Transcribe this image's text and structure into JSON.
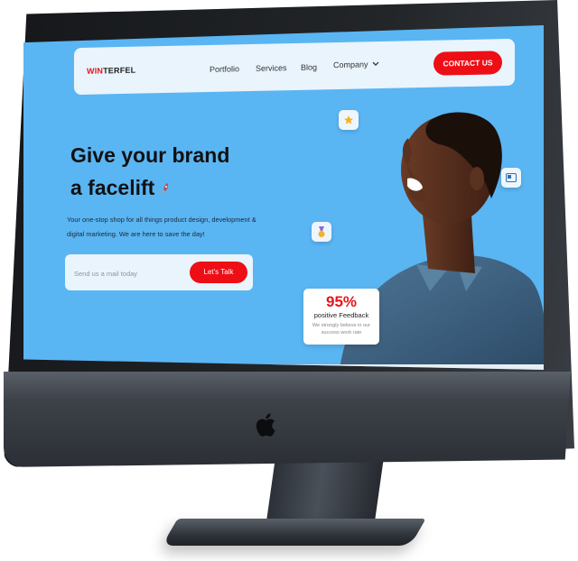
{
  "website": {
    "logo": {
      "part1": "WIN",
      "part2": "TERFEL"
    },
    "nav": {
      "items": [
        "Portfolio",
        "Services",
        "Blog",
        "Company"
      ],
      "contact_button": "CONTACT US"
    },
    "hero": {
      "title_line1": "Give your brand",
      "title_line2": "a facelift",
      "description": "Your one-stop shop for all things product design, development & digital marketing. We are here to save the day!",
      "email_placeholder": "Send us a mail today",
      "cta_button": "Let's Talk"
    },
    "feedback_card": {
      "percent": "95%",
      "label": "positive Feedback",
      "subtext": "We strongly believe in our success work rate"
    }
  },
  "colors": {
    "screen_background": "#5ab5f3",
    "accent_red": "#ee0e15",
    "navbar_background": "#e9f4fd"
  },
  "icons": [
    "apple-logo",
    "rocket-icon",
    "star-icon",
    "medal-icon",
    "card-icon",
    "chevron-down-icon"
  ]
}
